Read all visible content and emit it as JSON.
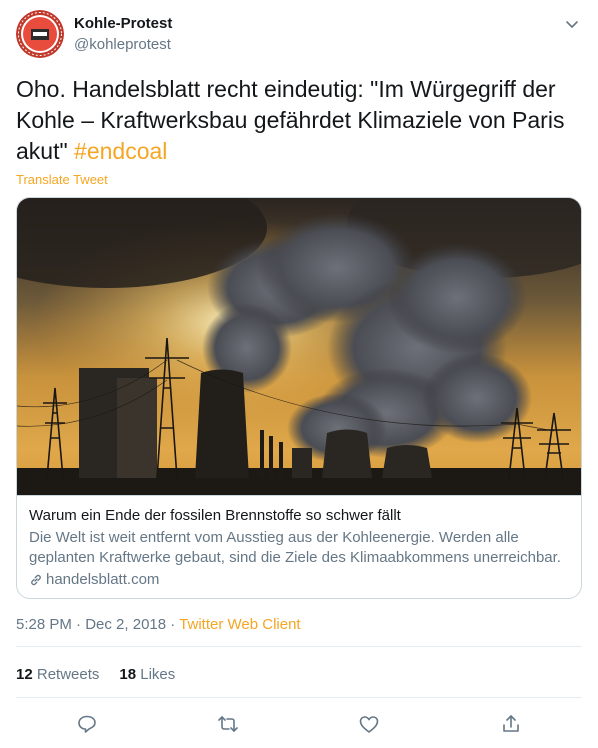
{
  "user": {
    "name": "Kohle-Protest",
    "handle": "@kohleprotest"
  },
  "tweet": {
    "text": "Oho. Handelsblatt recht eindeutig: \"Im Würgegriff der Kohle – Kraftwerksbau gefährdet Klimaziele von Paris akut\"",
    "hashtag": "#endcoal",
    "translate_label": "Translate Tweet"
  },
  "card": {
    "title": "Warum ein Ende der fossilen Brennstoffe so schwer fällt",
    "description": "Die Welt ist weit entfernt vom Ausstieg aus der Kohleenergie. Werden alle geplanten Kraftwerke gebaut, sind die Ziele des Klimaabkommens unerreichbar.",
    "domain": "handelsblatt.com"
  },
  "meta": {
    "time": "5:28 PM",
    "separator": " · ",
    "date": "Dec 2, 2018",
    "client": "Twitter Web Client"
  },
  "stats": {
    "retweets_count": "12",
    "retweets_label": "Retweets",
    "likes_count": "18",
    "likes_label": "Likes"
  },
  "icons": {
    "avatar": "stop-coal-logo",
    "caret": "chevron-down-icon",
    "link": "link-icon",
    "reply": "reply-icon",
    "retweet": "retweet-icon",
    "like": "heart-icon",
    "share": "share-icon"
  },
  "colors": {
    "accent": "#f5a623",
    "text": "#14171a",
    "secondary": "#657786",
    "border": "#ccd6dd"
  }
}
